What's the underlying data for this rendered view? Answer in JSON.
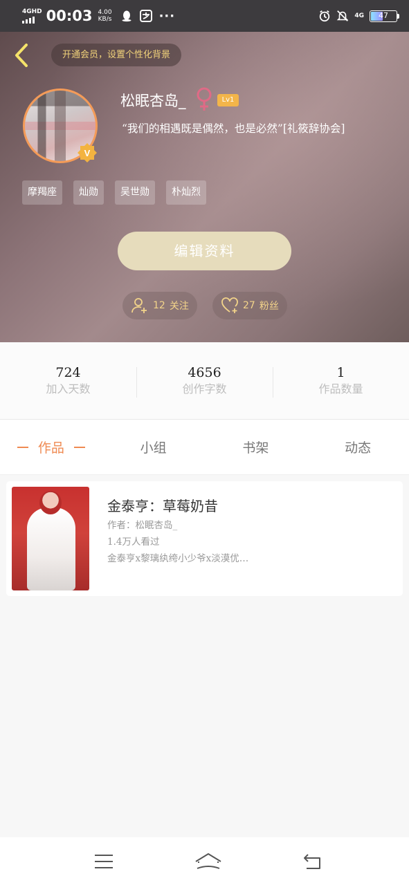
{
  "status_bar": {
    "network": "4GHD",
    "time": "00:03",
    "speed_value": "4.00",
    "speed_unit": "KB/s",
    "more": "···",
    "network_right": "4G",
    "battery": "47",
    "battery_level": 0.47
  },
  "header": {
    "vip_banner": "开通会员，设置个性化背景",
    "username": "松眠杏岛_",
    "gender": "female",
    "level": "Lv1",
    "signature": "“我们的相遇既是偶然，也是必然”[礼筱辞协会]",
    "tags": [
      "摩羯座",
      "灿勋",
      "吴世勋",
      "朴灿烈"
    ],
    "edit_button": "编辑资料",
    "following_count": "12",
    "following_label": "关注",
    "fans_count": "27",
    "fans_label": "粉丝"
  },
  "stats": [
    {
      "value": "724",
      "label": "加入天数"
    },
    {
      "value": "4656",
      "label": "创作字数"
    },
    {
      "value": "1",
      "label": "作品数量"
    }
  ],
  "tabs": [
    "作品",
    "小组",
    "书架",
    "动态"
  ],
  "works": [
    {
      "title": "金泰亨：草莓奶昔",
      "author": "作者：松眠杏岛_",
      "views": "1.4万人看过",
      "tags": "金泰亨x黎璃纨绔小少爷x淡漠优…"
    }
  ],
  "colors": {
    "accent": "#ef8a52",
    "gold": "#f3d48a",
    "edit_button_bg": "#e6dcbc"
  }
}
